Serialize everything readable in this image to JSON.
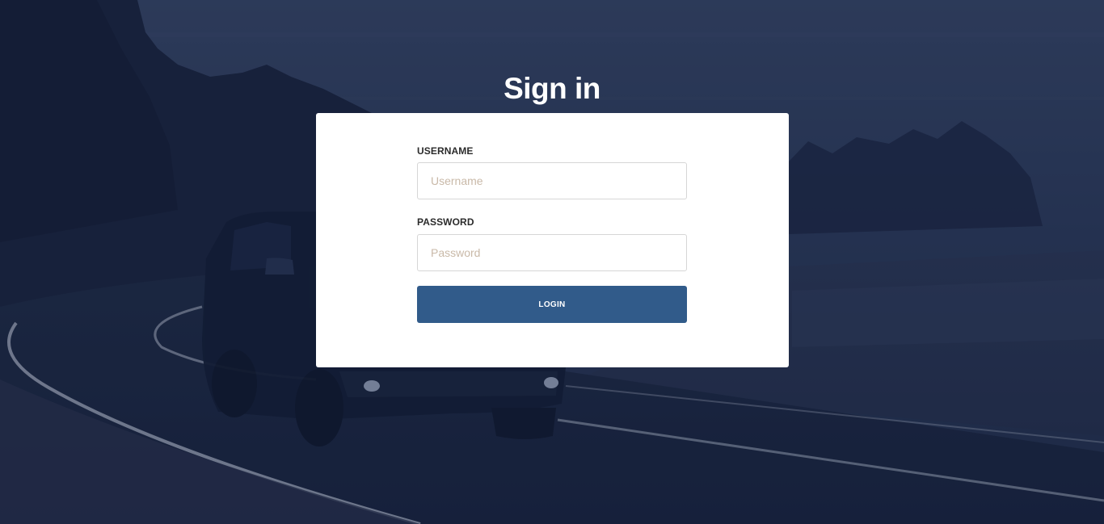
{
  "page": {
    "title": "Sign in"
  },
  "form": {
    "username_label": "USERNAME",
    "username_placeholder": "Username",
    "username_value": "",
    "password_label": "PASSWORD",
    "password_placeholder": "Password",
    "password_value": "",
    "login_label": "LOGIN"
  },
  "colors": {
    "button": "#315b8a",
    "card": "#ffffff",
    "background_overlay": "#142142"
  }
}
